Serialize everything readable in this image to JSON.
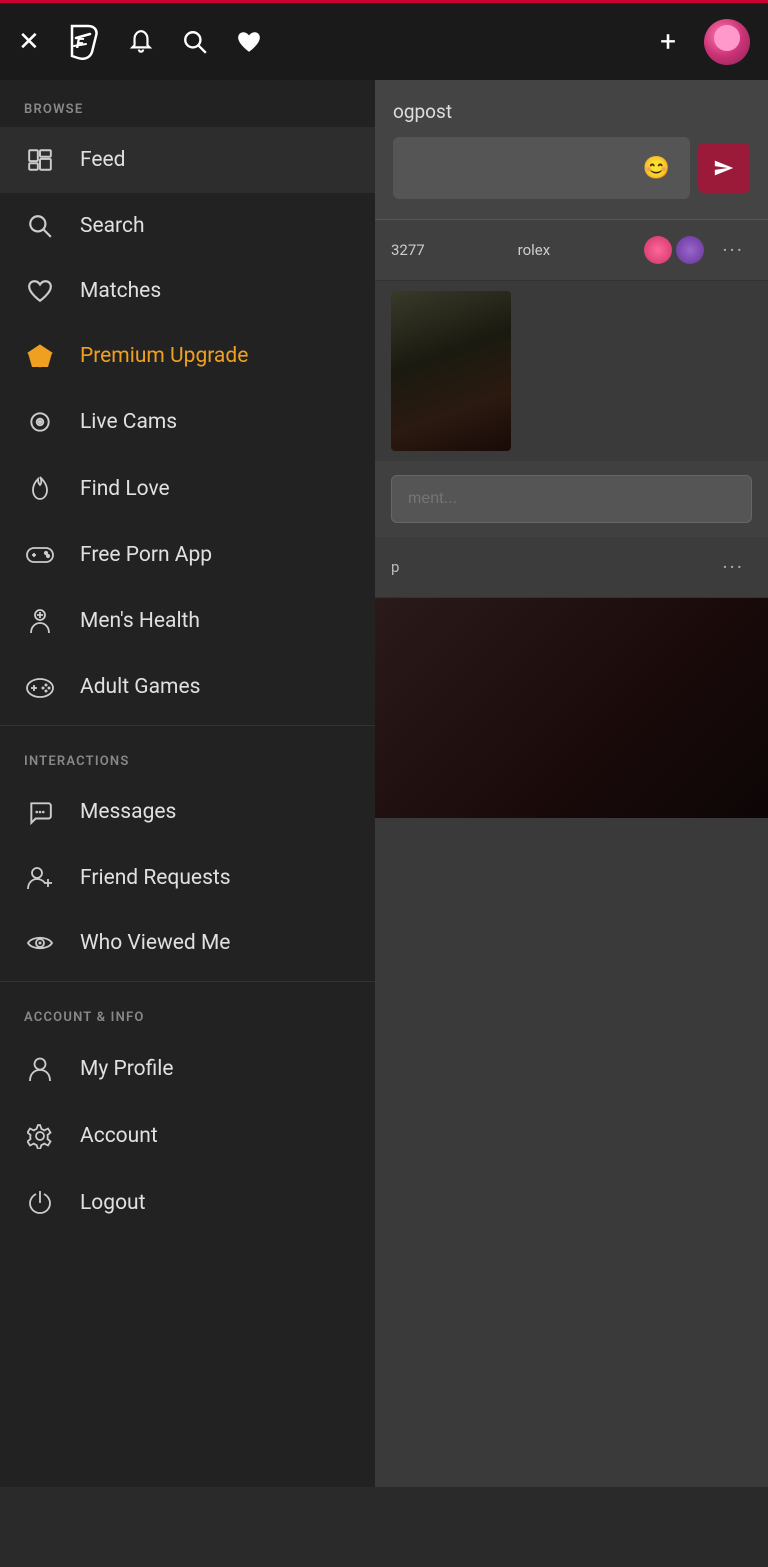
{
  "header": {
    "close_label": "✕",
    "logo_label": "F",
    "bell_label": "🔔",
    "search_label": "🔍",
    "heart_label": "♥",
    "plus_label": "+",
    "status_bar_color": "#cc0033"
  },
  "sidebar": {
    "browse_section_label": "BROWSE",
    "interactions_section_label": "INTERACTIONS",
    "account_section_label": "ACCOUNT & INFO",
    "items_browse": [
      {
        "id": "feed",
        "label": "Feed",
        "icon": "feed"
      },
      {
        "id": "search",
        "label": "Search",
        "icon": "search"
      },
      {
        "id": "matches",
        "label": "Matches",
        "icon": "heart"
      },
      {
        "id": "premium",
        "label": "Premium Upgrade",
        "icon": "diamond",
        "premium": true
      },
      {
        "id": "live-cams",
        "label": "Live Cams",
        "icon": "camera"
      },
      {
        "id": "find-love",
        "label": "Find Love",
        "icon": "flame"
      },
      {
        "id": "free-porn-app",
        "label": "Free Porn App",
        "icon": "gamepad"
      },
      {
        "id": "mens-health",
        "label": "Men's Health",
        "icon": "person"
      },
      {
        "id": "adult-games",
        "label": "Adult Games",
        "icon": "controller"
      }
    ],
    "items_interactions": [
      {
        "id": "messages",
        "label": "Messages",
        "icon": "chat"
      },
      {
        "id": "friend-requests",
        "label": "Friend Requests",
        "icon": "person-plus"
      },
      {
        "id": "who-viewed-me",
        "label": "Who Viewed Me",
        "icon": "eye"
      }
    ],
    "items_account": [
      {
        "id": "my-profile",
        "label": "My Profile",
        "icon": "person"
      },
      {
        "id": "account",
        "label": "Account",
        "icon": "gear"
      },
      {
        "id": "logout",
        "label": "Logout",
        "icon": "power"
      }
    ]
  },
  "content": {
    "blogpost_label": "ogpost",
    "emoji_placeholder": "😊",
    "post_user": "3277",
    "post_username": "rolex",
    "comment_placeholder": "ment...",
    "more_dots": "···"
  }
}
